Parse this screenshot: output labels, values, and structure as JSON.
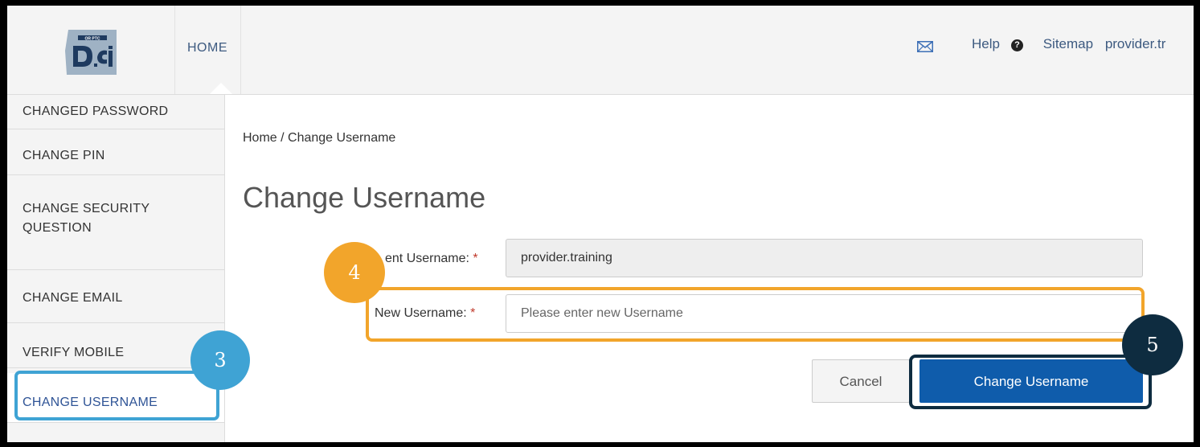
{
  "header": {
    "logo_text": "OR PTC DCI",
    "home_tab": "HOME",
    "help_label": "Help",
    "sitemap_label": "Sitemap",
    "user_label": "provider.tr"
  },
  "sidebar": {
    "items": [
      {
        "label": "CHANGED PASSWORD"
      },
      {
        "label": "CHANGE PIN"
      },
      {
        "label": "CHANGE SECURITY QUESTION"
      },
      {
        "label": "CHANGE EMAIL"
      },
      {
        "label": "VERIFY MOBILE"
      },
      {
        "label": "CHANGE USERNAME",
        "active": true
      }
    ]
  },
  "main": {
    "breadcrumb": "Home / Change Username",
    "title": "Change Username",
    "current_label": "ent Username:",
    "current_value": "provider.training",
    "new_label": "New Username:",
    "new_placeholder": "Please enter new Username",
    "required_mark": "*",
    "cancel_label": "Cancel",
    "submit_label": "Change Username"
  },
  "callouts": [
    {
      "number": "3",
      "color": "#3fa3d4"
    },
    {
      "number": "4",
      "color": "#f2a52b"
    },
    {
      "number": "5",
      "color": "#0e2c40"
    }
  ],
  "colors": {
    "primary": "#0f5cab",
    "link": "#3d5a80",
    "required": "#c0392b"
  }
}
